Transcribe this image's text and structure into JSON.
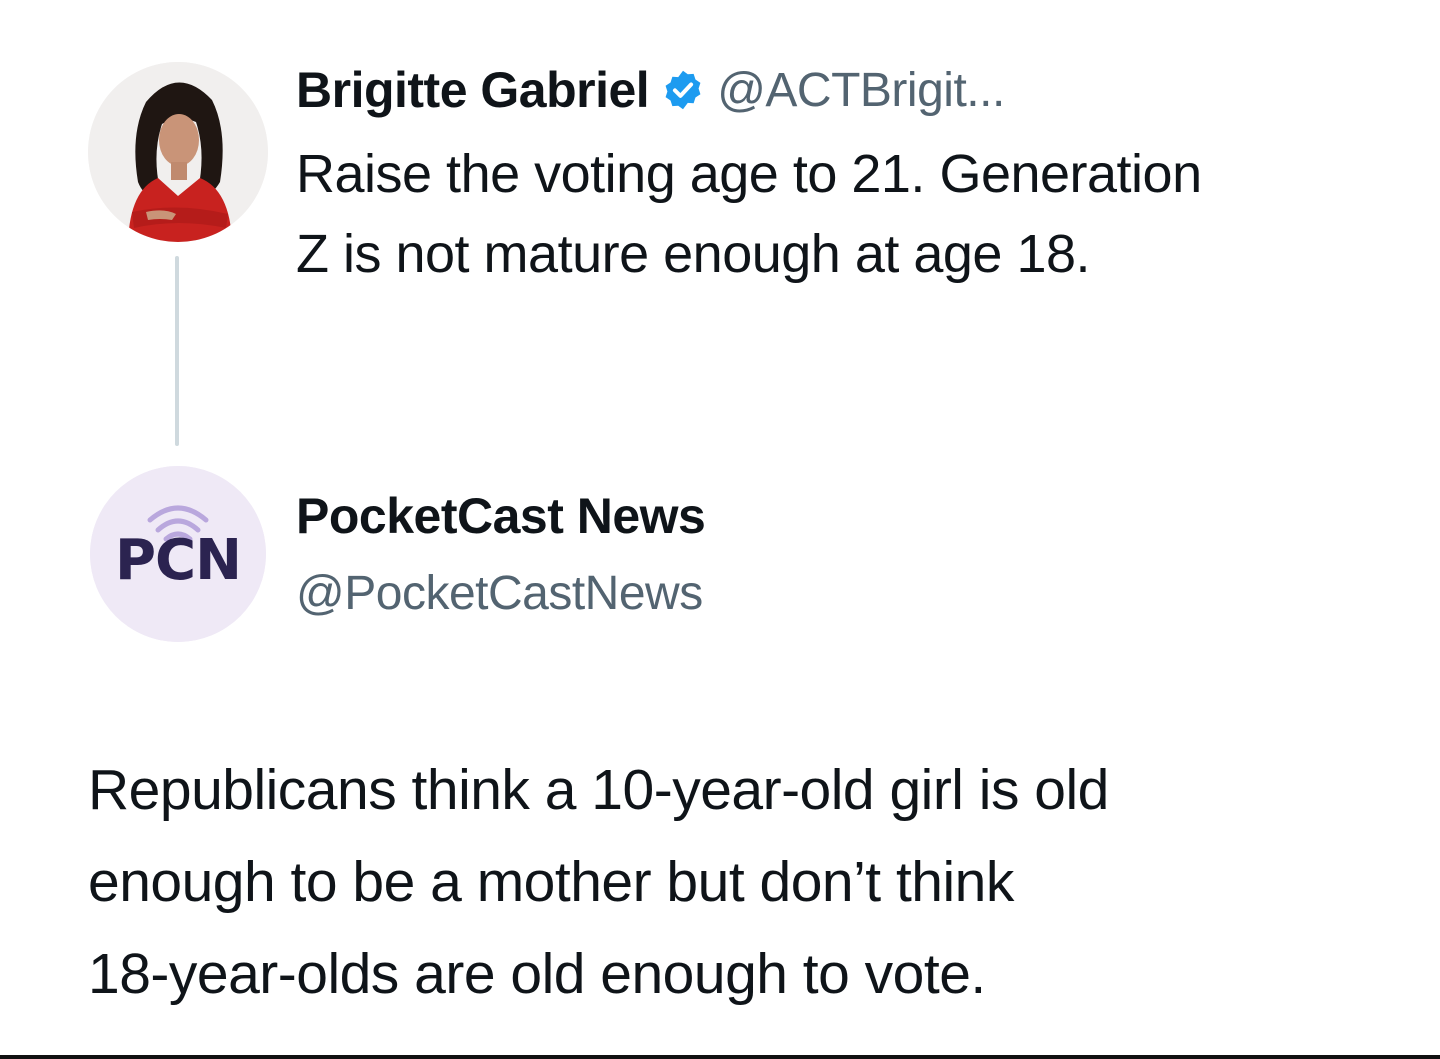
{
  "quoted_tweet": {
    "avatar": "woman-portrait-avatar",
    "display_name": "Brigitte Gabriel",
    "verified_icon": "verified-badge-icon",
    "handle": "@ACTBrigit...",
    "text_lines": [
      "Raise the voting age to 21. Generation",
      "Z is not mature enough at age 18."
    ]
  },
  "reply": {
    "avatar_logo_text": "PCN",
    "avatar_icon": "broadcast-signal-icon",
    "display_name": "PocketCast News",
    "handle": "@PocketCastNews",
    "text_lines": [
      "Republicans think a 10-year-old girl is old",
      "enough to be a mother but don’t think",
      "18-year-olds are old enough to vote."
    ]
  },
  "colors": {
    "text_primary": "#0f1419",
    "text_secondary": "#536471",
    "verified_blue": "#1d9bf0",
    "thread_line": "#cfd9de",
    "pcn_purple": "#2b2350",
    "avatar_bg_lavender": "#efe9f6"
  }
}
